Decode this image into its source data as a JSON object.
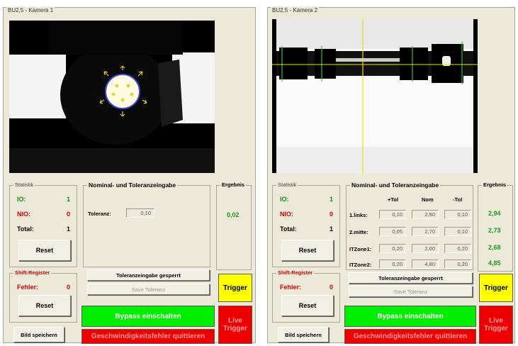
{
  "camera1": {
    "title": "BU2,5 - Kamera 1",
    "statistik": {
      "title": "Statistik",
      "io_label": "IO:",
      "io_value": "1",
      "nio_label": "NIO:",
      "nio_value": "0",
      "total_label": "Total:",
      "total_value": "1",
      "reset_label": "Reset"
    },
    "shift": {
      "title": "Shift-Register",
      "fehler_label": "Fehler:",
      "fehler_value": "0",
      "reset_label": "Reset"
    },
    "bild_speichern": "Bild speichern",
    "nominal": {
      "title": "Nominal- und Toleranzeingabe",
      "toleranz_label": "Toleranz:",
      "toleranz_value": "0,10"
    },
    "ergebnis": {
      "title": "Ergebnis",
      "value": "0,02"
    },
    "gesperrt_label": "Toleranzeingabe gesperrt",
    "save_label": "Save Toleranz",
    "trigger_label": "Trigger",
    "bypass_label": "Bypass einschalten",
    "geschw_label": "Geschwindigkeitsfehler quittieren",
    "live_label": "Live Trigger"
  },
  "camera2": {
    "title": "BU2,5 - Kamera 2",
    "statistik": {
      "title": "Statistik",
      "io_label": "IO:",
      "io_value": "1",
      "nio_label": "NIO:",
      "nio_value": "0",
      "total_label": "Total:",
      "total_value": "1",
      "reset_label": "Reset"
    },
    "shift": {
      "title": "Shift-Register",
      "fehler_label": "Fehler:",
      "fehler_value": "0",
      "reset_label": "Reset"
    },
    "bild_speichern": "Bild speichern",
    "nominal": {
      "title": "Nominal- und Toleranzeingabe",
      "col_plus": "+Tol",
      "col_nom": "Nom",
      "col_minus": "-Tol",
      "rows": [
        {
          "label": "1.links:",
          "plus": "0,10",
          "nom": "2,90",
          "minus": "0,10",
          "result": "2,94"
        },
        {
          "label": "2.mitte:",
          "plus": "0,05",
          "nom": "2,70",
          "minus": "0,10",
          "result": "2,73"
        },
        {
          "label": "ITZone1:",
          "plus": "0,20",
          "nom": "2,60",
          "minus": "0,20",
          "result": "2,68"
        },
        {
          "label": "ITZone2:",
          "plus": "0,20",
          "nom": "4,80",
          "minus": "0,20",
          "result": "4,85"
        }
      ]
    },
    "ergebnis": {
      "title": "Ergebnis"
    },
    "gesperrt_label": "Toleranzeingabe gesperrt",
    "save_label": "Save Toleranz",
    "trigger_label": "Trigger",
    "bypass_label": "Bypass einschalten",
    "geschw_label": "Geschwindigkeitsfehler quittieren",
    "live_label": "Live Trigger"
  }
}
